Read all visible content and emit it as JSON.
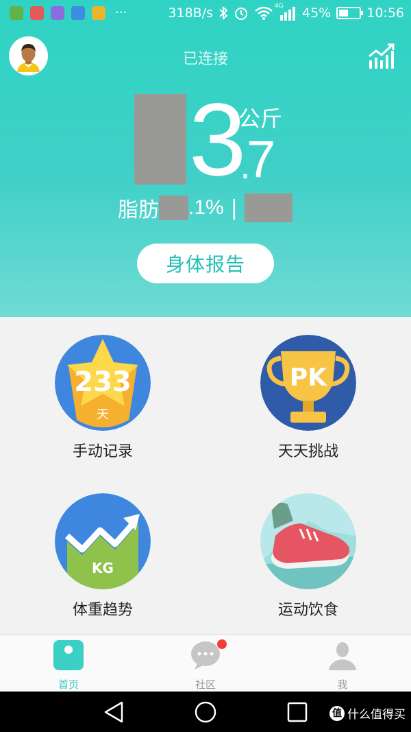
{
  "status_bar": {
    "net_speed": "318B/s",
    "signal_type": "4G",
    "battery_percent": "45%",
    "battery_level": 0.45,
    "time": "10:56"
  },
  "header": {
    "title": "已连接"
  },
  "weight": {
    "integer_visible": "3",
    "decimal": "7",
    "unit": "公斤"
  },
  "body_fat": {
    "label": "脂肪",
    "value_visible": ".1%",
    "separator": "|"
  },
  "report_button": {
    "label": "身体报告"
  },
  "tiles": [
    {
      "label": "手动记录",
      "badge_number": "233",
      "badge_unit": "天"
    },
    {
      "label": "天天挑战",
      "badge_text": "PK"
    },
    {
      "label": "体重趋势",
      "badge_text": "KG"
    },
    {
      "label": "运动饮食"
    }
  ],
  "tabs": [
    {
      "label": "首页",
      "active": true
    },
    {
      "label": "社区",
      "active": false
    },
    {
      "label": "我",
      "active": false
    }
  ],
  "watermark": {
    "logo_char": "值",
    "text": "什么值得买"
  },
  "colors": {
    "teal": "#2fd3c4",
    "teal_text": "#20bfb5",
    "active_tab": "#3cc9c2",
    "notification_red": "#f23b3b"
  }
}
